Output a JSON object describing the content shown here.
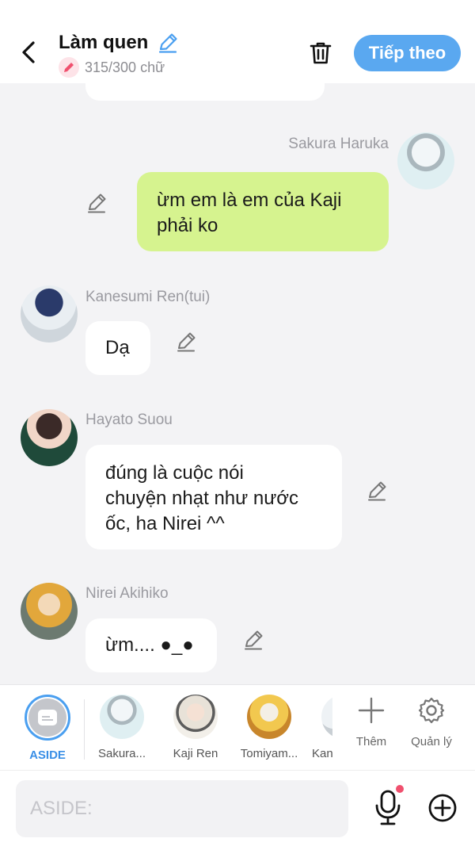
{
  "header": {
    "title": "Làm quen",
    "counter": "315/300 chữ",
    "next_label": "Tiếp theo"
  },
  "messages": [
    {
      "sender": "Sakura Haruka",
      "text_lines": [
        "ừm em là em của Kaji",
        "phải ko"
      ],
      "side": "right"
    },
    {
      "sender": "Kanesumi Ren(tui)",
      "text_lines": [
        "Dạ"
      ],
      "side": "left"
    },
    {
      "sender": "Hayato Suou",
      "text_lines": [
        "đúng là cuộc nói",
        "chuyện nhạt như nước",
        "ốc, ha Nirei ^^"
      ],
      "side": "left"
    },
    {
      "sender": "Nirei Akihiko",
      "text_lines": [
        "ừm.... ●_●"
      ],
      "side": "left"
    }
  ],
  "characters": [
    {
      "label": "ASIDE",
      "active": true
    },
    {
      "label": "Sakura..."
    },
    {
      "label": "Kaji Ren"
    },
    {
      "label": "Tomiyam..."
    },
    {
      "label": "Kan"
    }
  ],
  "tools": {
    "add_label": "Thêm",
    "manage_label": "Quản lý"
  },
  "input": {
    "placeholder": "ASIDE:"
  },
  "colors": {
    "accent": "#5aa8f0",
    "own_bubble": "#d6f38f",
    "notify": "#f0506e"
  }
}
